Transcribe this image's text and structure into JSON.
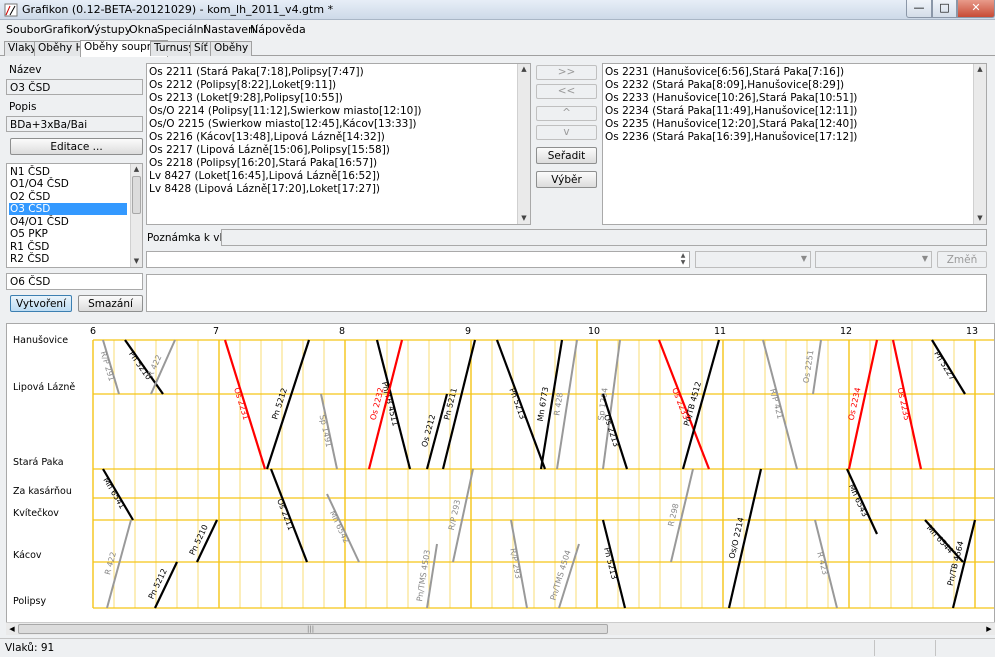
{
  "window": {
    "title": "Grafikon (0.12-BETA-20121029) - kom_lh_2011_v4.gtm *",
    "minimize": "—",
    "maximize": "□",
    "close": "✕"
  },
  "menu": [
    "Soubor",
    "Grafikon",
    "Výstupy",
    "Okna",
    "Speciální",
    "Nastavení",
    "Nápověda"
  ],
  "tabs": [
    "Vlaky",
    "Oběhy HV",
    "Oběhy souprav",
    "Turnusy",
    "Síť",
    "Oběhy"
  ],
  "active_tab": "Oběhy souprav",
  "left_panel": {
    "name_label": "Název",
    "name_value": "O3 ČSD",
    "desc_label": "Popis",
    "desc_value": "BDa+3xBa/Bai",
    "edit_button": "Editace ...",
    "circulations": [
      "N1 ČSD",
      "O1/O4 ČSD",
      "O2 ČSD",
      "O3 ČSD",
      "O4/O1 ČSD",
      "O5 PKP",
      "R1 ČSD",
      "R2 ČSD"
    ],
    "selected_circulation": "O3 ČSD",
    "new_name_value": "O6 ČSD",
    "create_button": "Vytvoření",
    "delete_button": "Smazání"
  },
  "available_trains": [
    "Os 2211 (Stará Paka[7:18],Polipsy[7:47])",
    "Os 2212 (Polipsy[8:22],Loket[9:11])",
    "Os 2213 (Loket[9:28],Polipsy[10:55])",
    "Os/O 2214 (Polipsy[11:12],Swierkow miasto[12:10])",
    "Os/O 2215 (Swierkow miasto[12:45],Kácov[13:33])",
    "Os 2216 (Kácov[13:48],Lipová Lázně[14:32])",
    "Os 2217 (Lipová Lázně[15:06],Polipsy[15:58])",
    "Os 2218 (Polipsy[16:20],Stará Paka[16:57])",
    "Lv 8427 (Loket[16:45],Lipová Lázně[16:52])",
    "Lv 8428 (Lipová Lázně[17:20],Loket[17:27])"
  ],
  "middle_buttons": {
    "add_all": ">>",
    "remove_all": "<<",
    "move_up": "^",
    "move_down": "v",
    "sort": "Seřadit",
    "select": "Výběr"
  },
  "assigned_trains": [
    "Os 2231 (Hanušovice[6:56],Stará Paka[7:16])",
    "Os 2232 (Stará Paka[8:09],Hanušovice[8:29])",
    "Os 2233 (Hanušovice[10:26],Stará Paka[10:51])",
    "Os 2234 (Stará Paka[11:49],Hanušovice[12:11])",
    "Os 2235 (Hanušovice[12:20],Stará Paka[12:40])",
    "Os 2236 (Stará Paka[16:39],Hanušovice[17:12])"
  ],
  "note_label": "Poznámka k vlaku:",
  "change_button": "Změň",
  "graph": {
    "stations": [
      "Hanušovice",
      "Lipová Lázně",
      "Stará Paka",
      "Za kasárňou",
      "Kvítečkov",
      "Kácov",
      "Polipsy"
    ],
    "hours": [
      "6",
      "7",
      "8",
      "9",
      "10",
      "11",
      "12",
      "13"
    ],
    "grid_color": "#f5c518",
    "colors": {
      "selected": "#ff0000",
      "freight": "#999999",
      "passenger": "#000000"
    },
    "train_labels": [
      "R/P 291",
      "Pn 5210",
      "R 422",
      "Os 2231",
      "Pn 5212",
      "Pn/TB 4511",
      "Os 2232",
      "Pn 5211",
      "Pn 5213",
      "Mn 6773",
      "R 428",
      "Sp 1204",
      "Os 2233",
      "Pn/TB 4512",
      "R/P 421",
      "Os 2251",
      "Os 2234",
      "Os 2235",
      "Pn 5227",
      "Sp 1491",
      "Os 2212",
      "Os 2213",
      "R 298",
      "Mn 6541",
      "Os 2211",
      "Mn 6542",
      "R/P 293",
      "Pn/TMS 4504",
      "Pn/TMS 4503",
      "Os/O 2214",
      "R 423",
      "Mn 6543",
      "Pn/TB 4564",
      "Mn 6544"
    ]
  },
  "status": {
    "trains_count": "Vlaků: 91"
  }
}
